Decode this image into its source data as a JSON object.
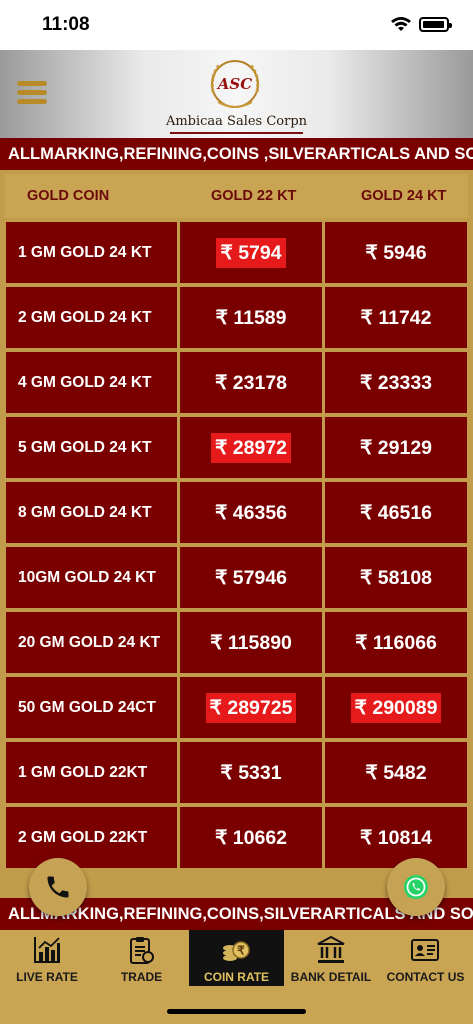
{
  "status": {
    "time": "11:08"
  },
  "header": {
    "logo_text": "ASC",
    "brand_name": "Ambicaa Sales Corpn"
  },
  "ticker": {
    "top_text": "ALLMARKING,REFINING,COINS ,SILVERARTICALS AND SOC",
    "bottom_text": "ALLMARKING,REFINING,COINS,SILVERARTICALS AND SOC"
  },
  "table": {
    "headers": [
      "GOLD COIN",
      "GOLD 22 KT",
      "GOLD 24 KT"
    ],
    "rows": [
      {
        "name": "1 GM GOLD 24 KT",
        "gold22": "₹ 5794",
        "gold24": "₹ 5946",
        "hl22": true,
        "hl24": false
      },
      {
        "name": "2 GM GOLD 24 KT",
        "gold22": "₹ 11589",
        "gold24": "₹ 11742",
        "hl22": false,
        "hl24": false
      },
      {
        "name": "4 GM GOLD 24 KT",
        "gold22": "₹ 23178",
        "gold24": "₹ 23333",
        "hl22": false,
        "hl24": false
      },
      {
        "name": "5 GM GOLD 24 KT",
        "gold22": "₹ 28972",
        "gold24": "₹ 29129",
        "hl22": true,
        "hl24": false
      },
      {
        "name": "8 GM GOLD 24 KT",
        "gold22": "₹ 46356",
        "gold24": "₹ 46516",
        "hl22": false,
        "hl24": false
      },
      {
        "name": "10GM GOLD 24 KT",
        "gold22": "₹ 57946",
        "gold24": "₹ 58108",
        "hl22": false,
        "hl24": false
      },
      {
        "name": "20 GM GOLD 24 KT",
        "gold22": "₹ 115890",
        "gold24": "₹ 116066",
        "hl22": false,
        "hl24": false
      },
      {
        "name": "50 GM GOLD 24CT",
        "gold22": "₹ 289725",
        "gold24": "₹ 290089",
        "hl22": true,
        "hl24": true
      },
      {
        "name": "1 GM GOLD 22KT",
        "gold22": "₹ 5331",
        "gold24": "₹ 5482",
        "hl22": false,
        "hl24": false
      },
      {
        "name": "2 GM GOLD 22KT",
        "gold22": "₹ 10662",
        "gold24": "₹ 10814",
        "hl22": false,
        "hl24": false
      }
    ]
  },
  "nav": {
    "items": [
      {
        "label": "LIVE RATE",
        "icon": "bar-chart-icon",
        "active": false
      },
      {
        "label": "TRADE",
        "icon": "clipboard-icon",
        "active": false
      },
      {
        "label": "COIN RATE",
        "icon": "coins-icon",
        "active": true
      },
      {
        "label": "BANK DETAIL",
        "icon": "bank-icon",
        "active": false
      },
      {
        "label": "CONTACT US",
        "icon": "contact-card-icon",
        "active": false
      }
    ]
  },
  "colors": {
    "maroon": "#7a0000",
    "gold": "#c9a453",
    "highlight_red": "#e61a1a"
  }
}
